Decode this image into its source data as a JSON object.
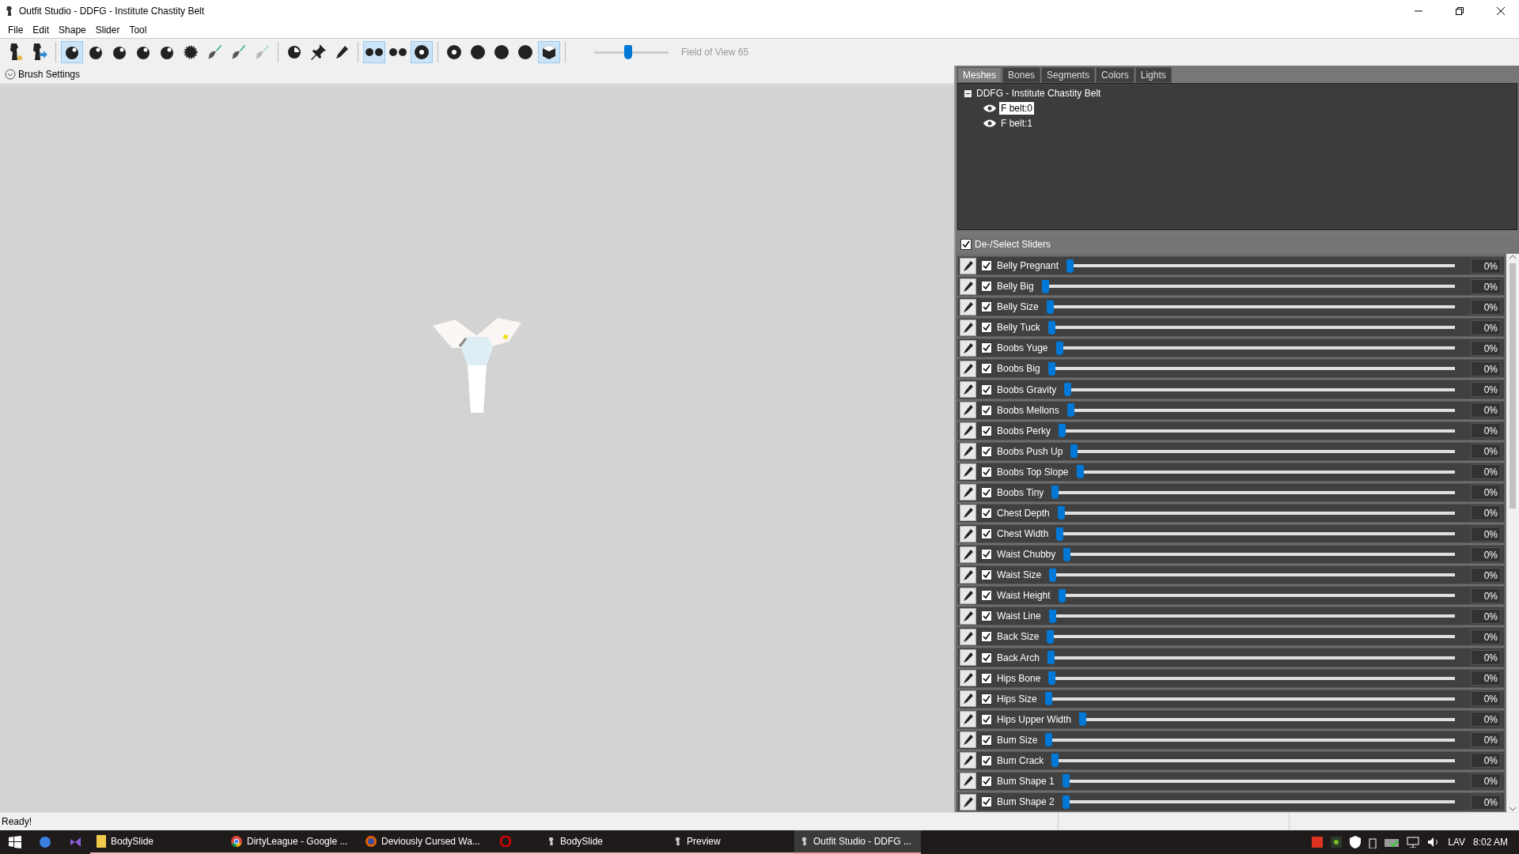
{
  "window": {
    "title": "Outfit Studio - DDFG - Institute Chastity Belt"
  },
  "menu": [
    "File",
    "Edit",
    "Shape",
    "Slider",
    "Tool"
  ],
  "toolbar": [
    [
      {
        "kind": "figure-star",
        "selected": false,
        "disabled": false
      },
      {
        "kind": "figure-arrow",
        "selected": false,
        "disabled": false
      }
    ],
    [
      {
        "kind": "sphere",
        "selected": true,
        "disabled": false
      },
      {
        "kind": "sphere",
        "selected": false,
        "disabled": false
      },
      {
        "kind": "sphere",
        "selected": false,
        "disabled": false
      },
      {
        "kind": "sphere",
        "selected": false,
        "disabled": false
      },
      {
        "kind": "sphere",
        "selected": false,
        "disabled": false
      },
      {
        "kind": "spiky",
        "selected": false,
        "disabled": false
      },
      {
        "kind": "paint",
        "selected": false,
        "disabled": false
      },
      {
        "kind": "paint",
        "selected": false,
        "disabled": false
      },
      {
        "kind": "paint",
        "selected": false,
        "disabled": true
      }
    ],
    [
      {
        "kind": "pie",
        "selected": false,
        "disabled": false
      },
      {
        "kind": "pin",
        "selected": false,
        "disabled": false
      },
      {
        "kind": "pencil",
        "selected": false,
        "disabled": false
      }
    ],
    [
      {
        "kind": "dots",
        "selected": true,
        "disabled": false
      },
      {
        "kind": "dots",
        "selected": false,
        "disabled": false
      },
      {
        "kind": "ring",
        "selected": true,
        "disabled": false
      }
    ],
    [
      {
        "kind": "ring",
        "selected": false,
        "disabled": false
      },
      {
        "kind": "disk",
        "selected": false,
        "disabled": false
      },
      {
        "kind": "disk",
        "selected": false,
        "disabled": false
      },
      {
        "kind": "disk",
        "selected": false,
        "disabled": false
      },
      {
        "kind": "cube",
        "selected": true,
        "disabled": false
      }
    ]
  ],
  "field_of_view": {
    "level": 0.45,
    "label": "Field of View 65"
  },
  "brush_settings": {
    "label": "Brush Settings",
    "expanded": false
  },
  "panel": {
    "tabs": [
      {
        "label": "Meshes",
        "selected": true
      },
      {
        "label": "Bones",
        "selected": false
      },
      {
        "label": "Segments",
        "selected": false
      },
      {
        "label": "Colors",
        "selected": false
      },
      {
        "label": "Lights",
        "selected": false
      }
    ],
    "tree": {
      "label": "DDFG - Institute Chastity Belt",
      "expanded": true,
      "children": [
        {
          "label": "F belt:0",
          "selected": true,
          "visible": true
        },
        {
          "label": "F belt:1",
          "selected": false,
          "visible": true
        }
      ]
    }
  },
  "sliders_header": {
    "label": "De-/Select Sliders",
    "checked": true
  },
  "sliders": [
    {
      "name": "Belly Pregnant",
      "checked": true,
      "level": 0,
      "value": "0%"
    },
    {
      "name": "Belly Big",
      "checked": true,
      "level": 0,
      "value": "0%"
    },
    {
      "name": "Belly Size",
      "checked": true,
      "level": 0,
      "value": "0%"
    },
    {
      "name": "Belly Tuck",
      "checked": true,
      "level": 0,
      "value": "0%"
    },
    {
      "name": "Boobs Yuge",
      "checked": true,
      "level": 0,
      "value": "0%"
    },
    {
      "name": "Boobs Big",
      "checked": true,
      "level": 0,
      "value": "0%"
    },
    {
      "name": "Boobs Gravity",
      "checked": true,
      "level": 0,
      "value": "0%"
    },
    {
      "name": "Boobs Mellons",
      "checked": true,
      "level": 0,
      "value": "0%"
    },
    {
      "name": "Boobs Perky",
      "checked": true,
      "level": 0,
      "value": "0%"
    },
    {
      "name": "Boobs Push Up",
      "checked": true,
      "level": 0,
      "value": "0%"
    },
    {
      "name": "Boobs Top Slope",
      "checked": true,
      "level": 0,
      "value": "0%"
    },
    {
      "name": "Boobs Tiny",
      "checked": true,
      "level": 0,
      "value": "0%"
    },
    {
      "name": "Chest Depth",
      "checked": true,
      "level": 0,
      "value": "0%"
    },
    {
      "name": "Chest Width",
      "checked": true,
      "level": 0,
      "value": "0%"
    },
    {
      "name": "Waist Chubby",
      "checked": true,
      "level": 0,
      "value": "0%"
    },
    {
      "name": "Waist Size",
      "checked": true,
      "level": 0,
      "value": "0%"
    },
    {
      "name": "Waist Height",
      "checked": true,
      "level": 0,
      "value": "0%"
    },
    {
      "name": "Waist Line",
      "checked": true,
      "level": 0,
      "value": "0%"
    },
    {
      "name": "Back Size",
      "checked": true,
      "level": 0,
      "value": "0%"
    },
    {
      "name": "Back Arch",
      "checked": true,
      "level": 0,
      "value": "0%"
    },
    {
      "name": "Hips Bone",
      "checked": true,
      "level": 0,
      "value": "0%"
    },
    {
      "name": "Hips Size",
      "checked": true,
      "level": 0,
      "value": "0%"
    },
    {
      "name": "Hips Upper Width",
      "checked": true,
      "level": 0,
      "value": "0%"
    },
    {
      "name": "Bum Size",
      "checked": true,
      "level": 0,
      "value": "0%"
    },
    {
      "name": "Bum Crack",
      "checked": true,
      "level": 0,
      "value": "0%"
    },
    {
      "name": "Bum Shape 1",
      "checked": true,
      "level": 0,
      "value": "0%"
    },
    {
      "name": "Bum Shape 2",
      "checked": true,
      "level": 0,
      "value": "0%"
    }
  ],
  "status_bar": {
    "text": "Ready!"
  },
  "taskbar": {
    "apps": [
      {
        "kind": "folder",
        "label": "BodySlide",
        "active": false
      },
      {
        "kind": "chrome",
        "label": "DirtyLeague - Google ...",
        "active": false
      },
      {
        "kind": "firefox",
        "label": "Deviously Cursed Wa...",
        "active": false
      },
      {
        "kind": "opera",
        "active": false
      },
      {
        "kind": "figure",
        "label": "BodySlide",
        "active": false
      },
      {
        "kind": "figure",
        "label": "Preview",
        "active": false
      },
      {
        "kind": "figure",
        "label": "Outfit Studio - DDFG ...",
        "active": true
      }
    ],
    "language": "LAV",
    "time": "8:02 AM"
  }
}
